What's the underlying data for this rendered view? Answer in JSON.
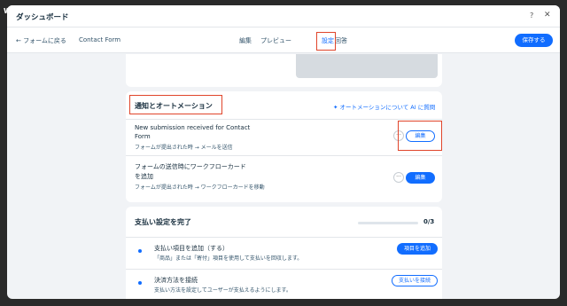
{
  "app": {
    "logo": "WIX",
    "title": "ダッシュボード",
    "help": "?",
    "close": "✕"
  },
  "toolbar": {
    "back": "← フォームに戻る",
    "form_name": "Contact Form",
    "tabs": [
      {
        "label": "編集"
      },
      {
        "label": "プレビュー"
      },
      {
        "label": "設定",
        "active": true
      },
      {
        "label": "回答"
      }
    ],
    "save": "保存する"
  },
  "automation": {
    "title": "通知とオートメーション",
    "ai_link": "オートメーションについて AI に質問",
    "rows": [
      {
        "title_line1": "New submission received for Contact",
        "title_line2": "Form",
        "subtitle": "フォームが提出された時 → メールを送信",
        "more": "···",
        "edit": "編集"
      },
      {
        "title_line1": "フォームの送信時にワークフローカード",
        "title_line2": "を追加",
        "subtitle": "フォームが提出された時 → ワークフローカードを移動",
        "more": "···",
        "edit": "編集"
      }
    ]
  },
  "payment": {
    "title": "支払い設定を完了",
    "progress_text": "0/3",
    "progress_value": 0,
    "items": [
      {
        "title": "支払い項目を追加（する）",
        "subtitle": "「商品」または「寄付」項目を使用して支払いを回収します。",
        "button": "項目を追加"
      },
      {
        "title": "決済方法を接続",
        "subtitle": "支払い方法を設定してユーザーが支払えるようにします。",
        "button": "支払いを接続"
      }
    ]
  },
  "colors": {
    "accent": "#116dff",
    "highlight": "#e0452b",
    "text": "#162d3d"
  }
}
